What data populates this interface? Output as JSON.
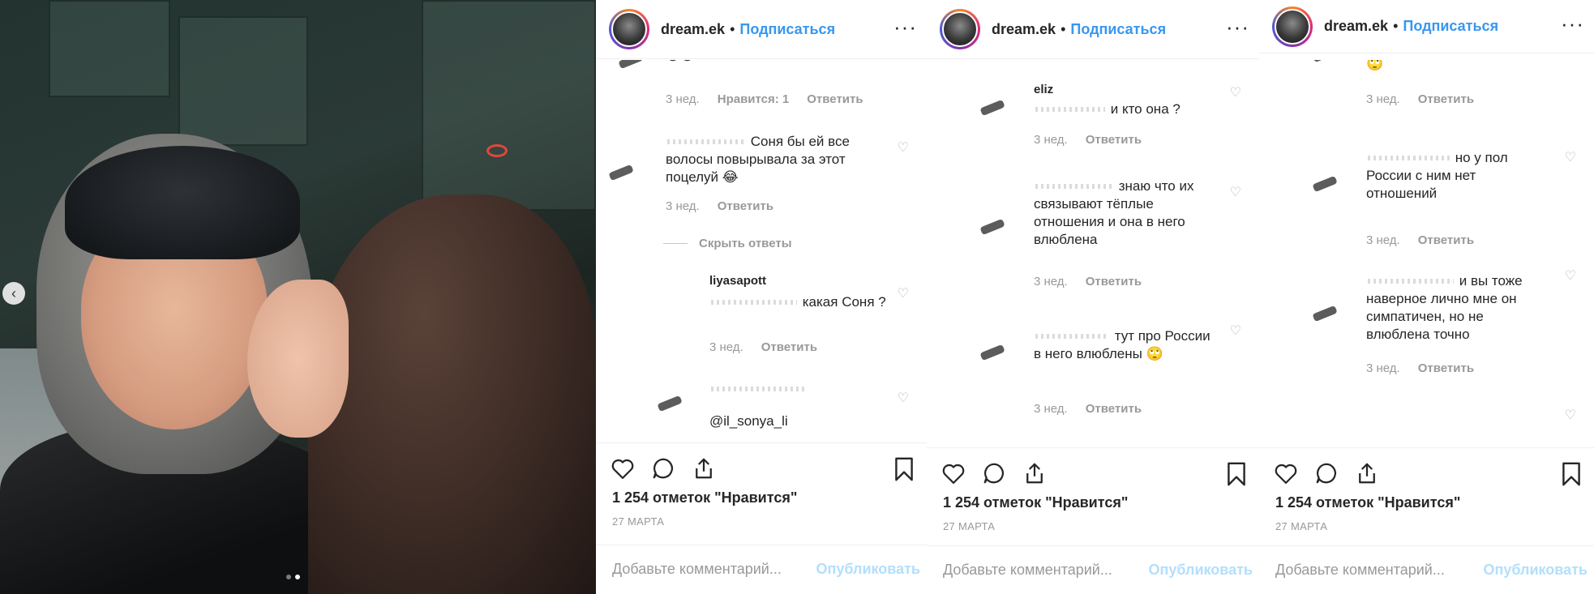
{
  "photo": {
    "nav_arrow": "‹",
    "dots": [
      false,
      true
    ]
  },
  "panels": [
    {
      "header": {
        "username": "dream.ek",
        "separator": "•",
        "follow": "Подписаться",
        "more": "···"
      },
      "comments": [
        {
          "text": "😍😍",
          "time": "3 нед.",
          "likes": "Нравится: 1",
          "reply": "Ответить"
        },
        {
          "prefix": "",
          "text": "Соня бы ей все волосы повырывала за этот поцелуй 😂",
          "time": "3 нед.",
          "reply": "Ответить"
        },
        {
          "hide": "Скрыть ответы"
        },
        {
          "name": "liyasapott",
          "text": "какая Соня ?",
          "time": "3 нед.",
          "reply": "Ответить"
        },
        {
          "text": "@il_sonya_li"
        }
      ],
      "likes_count": "1 254 отметок \"Нравится\"",
      "date": "27 МАРТА",
      "comment_placeholder": "Добавьте комментарий...",
      "publish": "Опубликовать"
    },
    {
      "header": {
        "username": "dream.ek",
        "separator": "•",
        "follow": "Подписаться",
        "more": "···"
      },
      "comments": [
        {
          "name": "eliz",
          "text": "и кто она ?",
          "time": "3 нед.",
          "reply": "Ответить"
        },
        {
          "text": "знаю что их связывают тёплые отношения и она в него влюблена",
          "time": "3 нед.",
          "reply": "Ответить"
        },
        {
          "text": "тут про России в него влюблены 🙄",
          "time": "3 нед.",
          "reply": "Ответить"
        }
      ],
      "likes_count": "1 254 отметок \"Нравится\"",
      "date": "27 МАРТА",
      "comment_placeholder": "Добавьте комментарий...",
      "publish": "Опубликовать"
    },
    {
      "header": {
        "username": "dream.ek",
        "separator": "•",
        "follow": "Подписаться",
        "more": "···"
      },
      "comments": [
        {
          "text": "🙄",
          "time": "3 нед.",
          "reply": "Ответить"
        },
        {
          "text": "но у пол России с ним нет отношений",
          "time": "3 нед.",
          "reply": "Ответить"
        },
        {
          "text": "и вы тоже наверное лично мне он симпатичен, но не влюблена точно",
          "time": "3 нед.",
          "reply": "Ответить"
        }
      ],
      "likes_count": "1 254 отметок \"Нравится\"",
      "date": "27 МАРТА",
      "comment_placeholder": "Добавьте комментарий...",
      "publish": "Опубликовать"
    }
  ],
  "icons": {
    "heart": "heart-icon",
    "comment": "comment-icon",
    "share": "share-icon",
    "bookmark": "bookmark-icon",
    "small_heart": "small-heart-icon"
  },
  "colors": {
    "link": "#3897f0",
    "muted": "#999999",
    "publish_disabled": "#b2dffc"
  }
}
